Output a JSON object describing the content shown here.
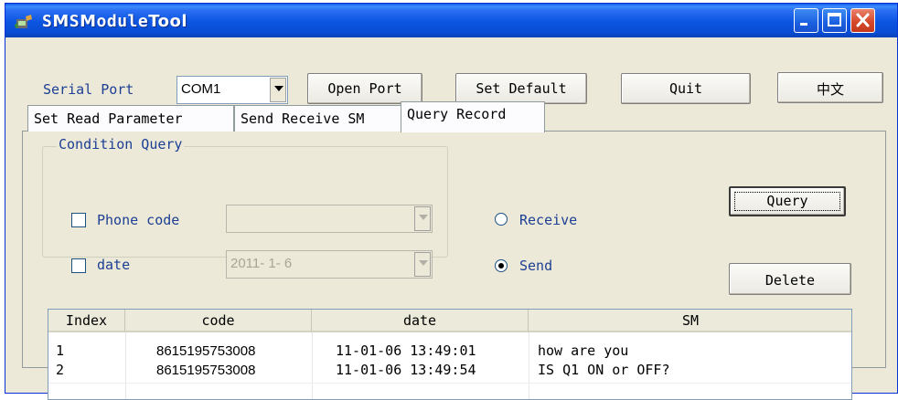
{
  "window": {
    "title": "SMSModuleTool",
    "title_display_lead": "S",
    "title_display_m": "M",
    "title_display_rest": "odule",
    "title_display_tool": "Tool",
    "accent_title": "#0a54e0",
    "accent_close": "#d8492c",
    "icons": [
      "app-icon",
      "minimize-icon",
      "maximize-icon",
      "close-icon"
    ]
  },
  "toolbar": {
    "serial_port_label": "Serial Port",
    "port_value": "COM1",
    "open_port": "Open Port",
    "set_default": "Set Default",
    "quit": "Quit",
    "language": "中文"
  },
  "tabs": [
    {
      "label": "Set Read Parameter",
      "active": false
    },
    {
      "label": "Send Receive SM",
      "active": false
    },
    {
      "label": "Query Record",
      "active": true
    }
  ],
  "query": {
    "group_title": "Condition Query",
    "phone_code_label": "Phone code",
    "phone_code_checked": false,
    "phone_code_value": "",
    "date_label": "date",
    "date_checked": false,
    "date_value": "2011- 1- 6",
    "receive_label": "Receive",
    "send_label": "Send",
    "selected_direction": "Send",
    "query_button": "Query",
    "delete_button": "Delete"
  },
  "records": {
    "columns": [
      "Index",
      "code",
      "date",
      "SM"
    ],
    "rows": [
      {
        "index": "1",
        "code": "8615195753008",
        "date": "11-01-06 13:49:01",
        "sm": "how are you"
      },
      {
        "index": "2",
        "code": "8615195753008",
        "date": "11-01-06 13:49:54",
        "sm": "IS Q1 ON or OFF?"
      }
    ]
  }
}
